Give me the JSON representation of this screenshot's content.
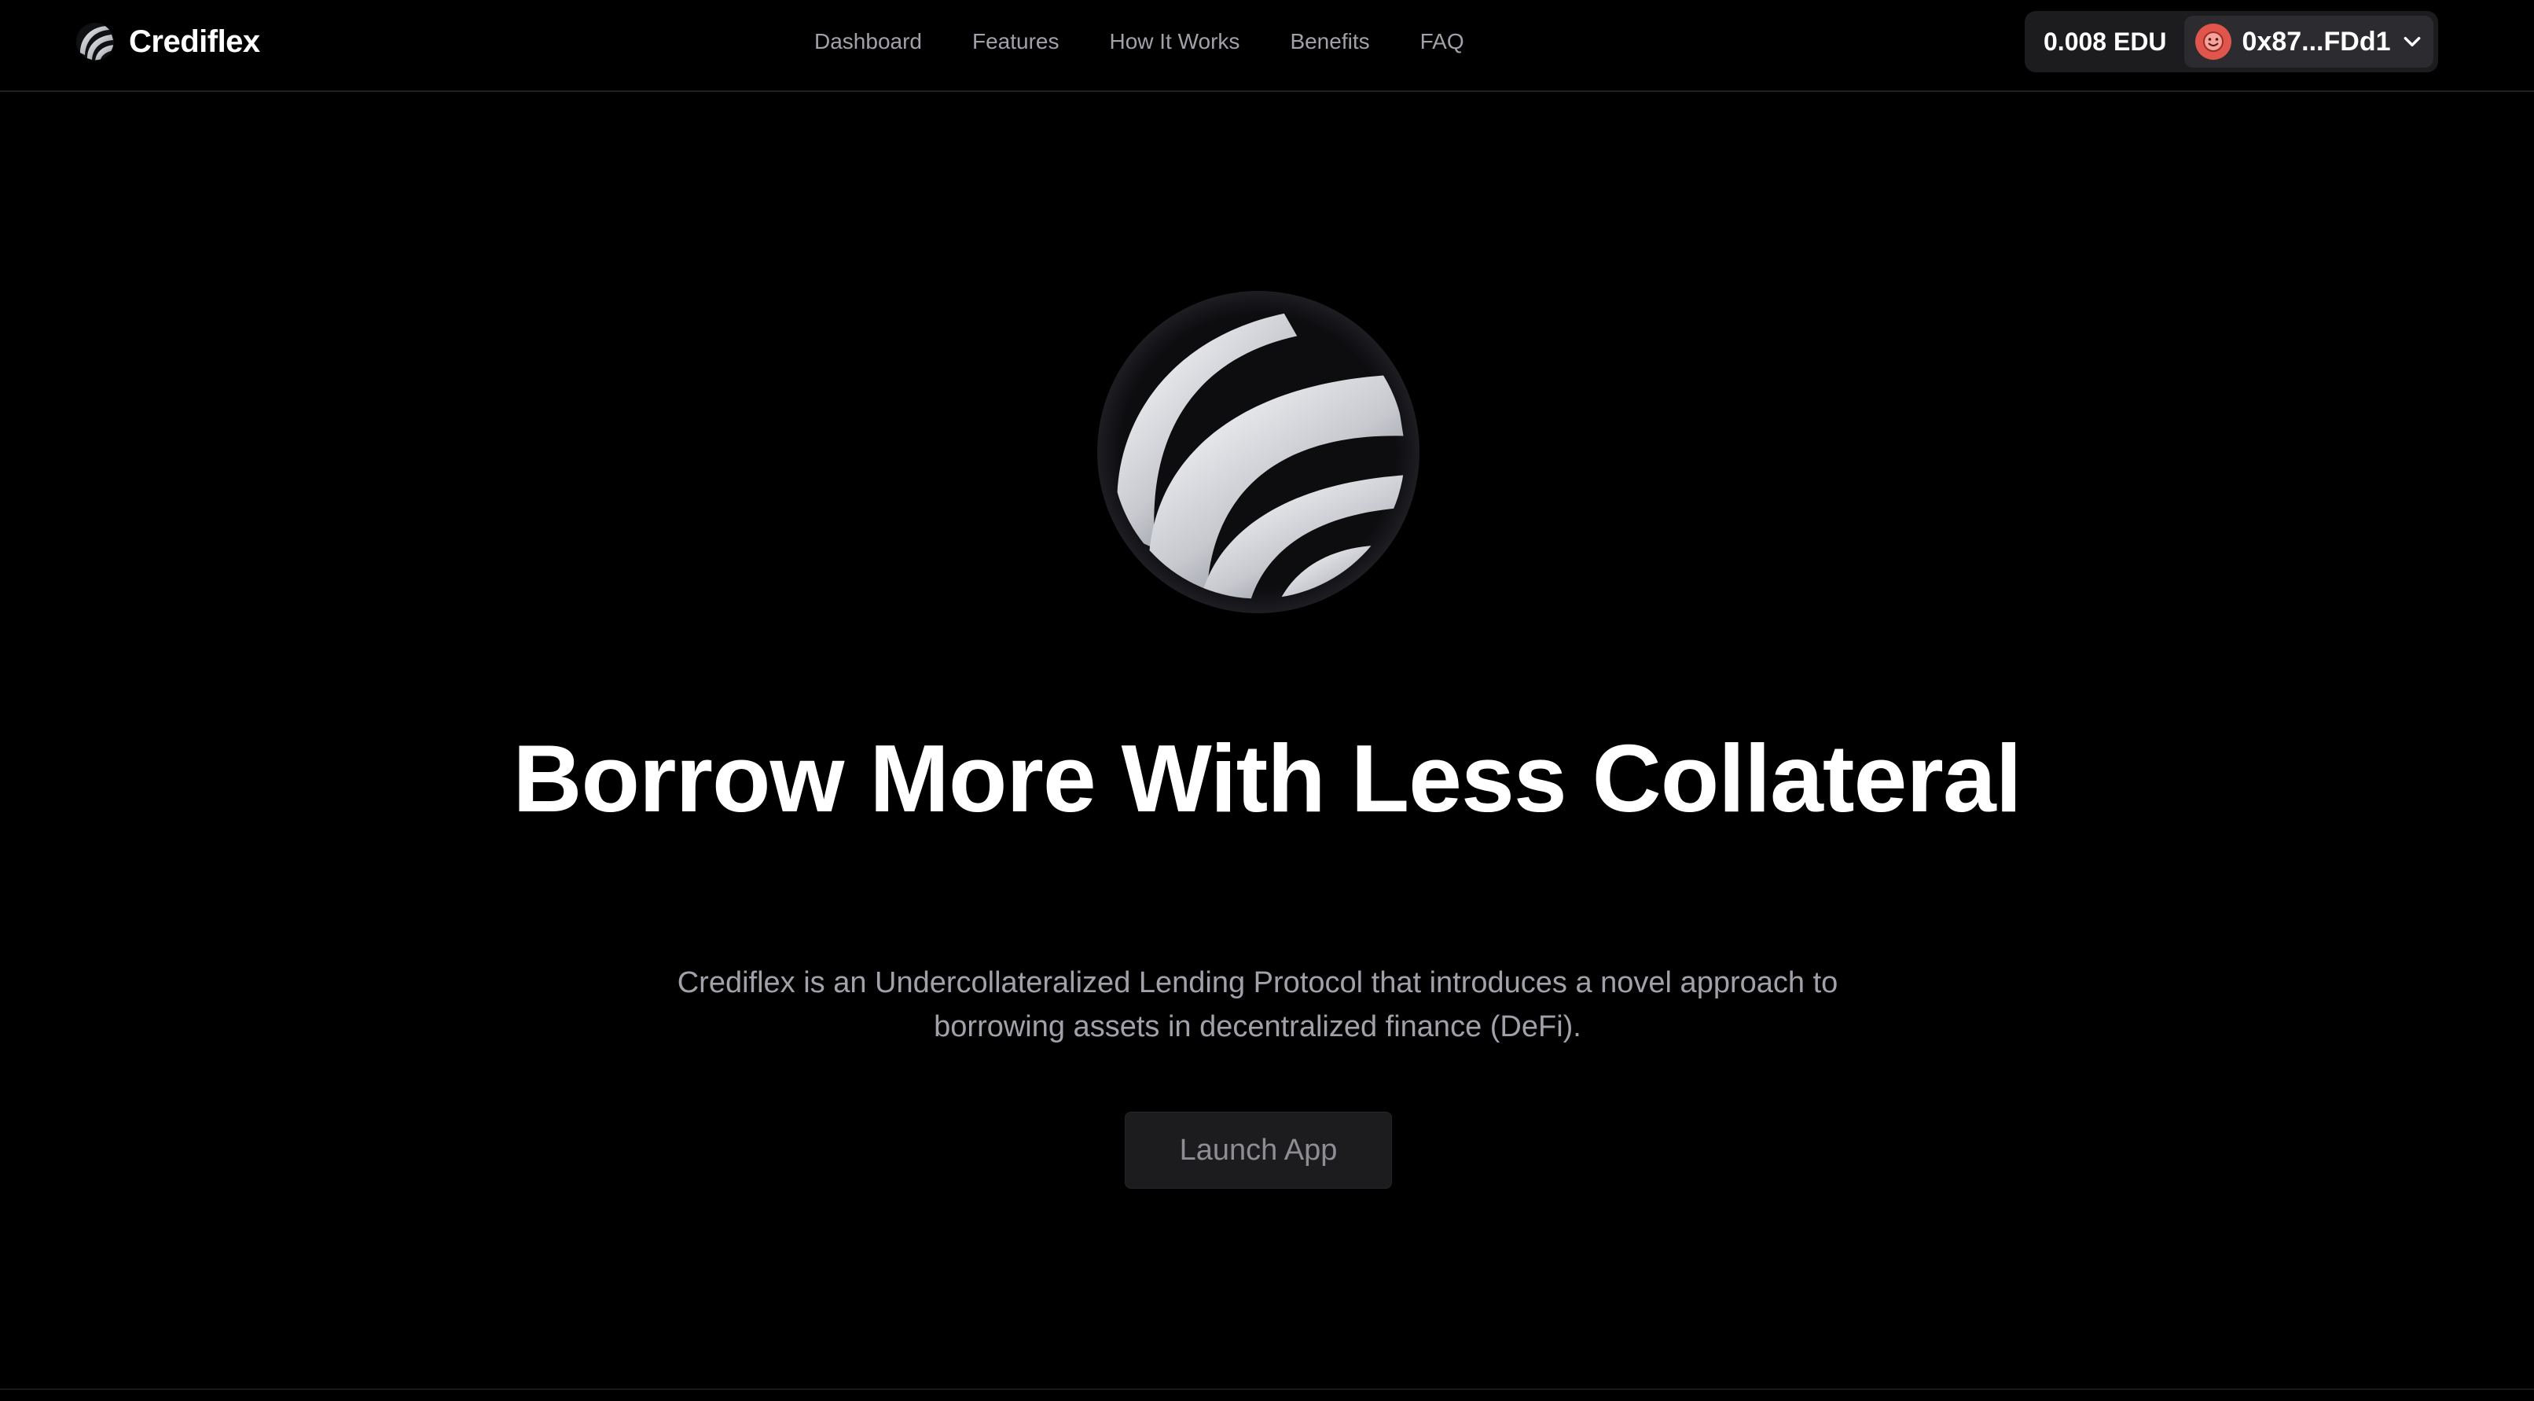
{
  "header": {
    "brand_name": "Crediflex",
    "nav": [
      {
        "label": "Dashboard"
      },
      {
        "label": "Features"
      },
      {
        "label": "How It Works"
      },
      {
        "label": "Benefits"
      },
      {
        "label": "FAQ"
      }
    ],
    "wallet": {
      "balance": "0.008 EDU",
      "address": "0x87...FDd1",
      "avatar_icon": "avatar-emoji-icon",
      "dropdown_icon": "chevron-down-icon"
    }
  },
  "hero": {
    "logo_icon": "crediflex-globe-logo",
    "title": "Borrow More With Less Collateral",
    "subtitle": "Crediflex is an Undercollateralized Lending Protocol that introduces a novel approach to borrowing assets in decentralized finance (DeFi).",
    "cta_label": "Launch App"
  },
  "colors": {
    "background": "#000000",
    "text_primary": "#ffffff",
    "text_muted": "#a1a1aa",
    "avatar": "#e0564d",
    "button_bg": "#1c1c1e"
  }
}
